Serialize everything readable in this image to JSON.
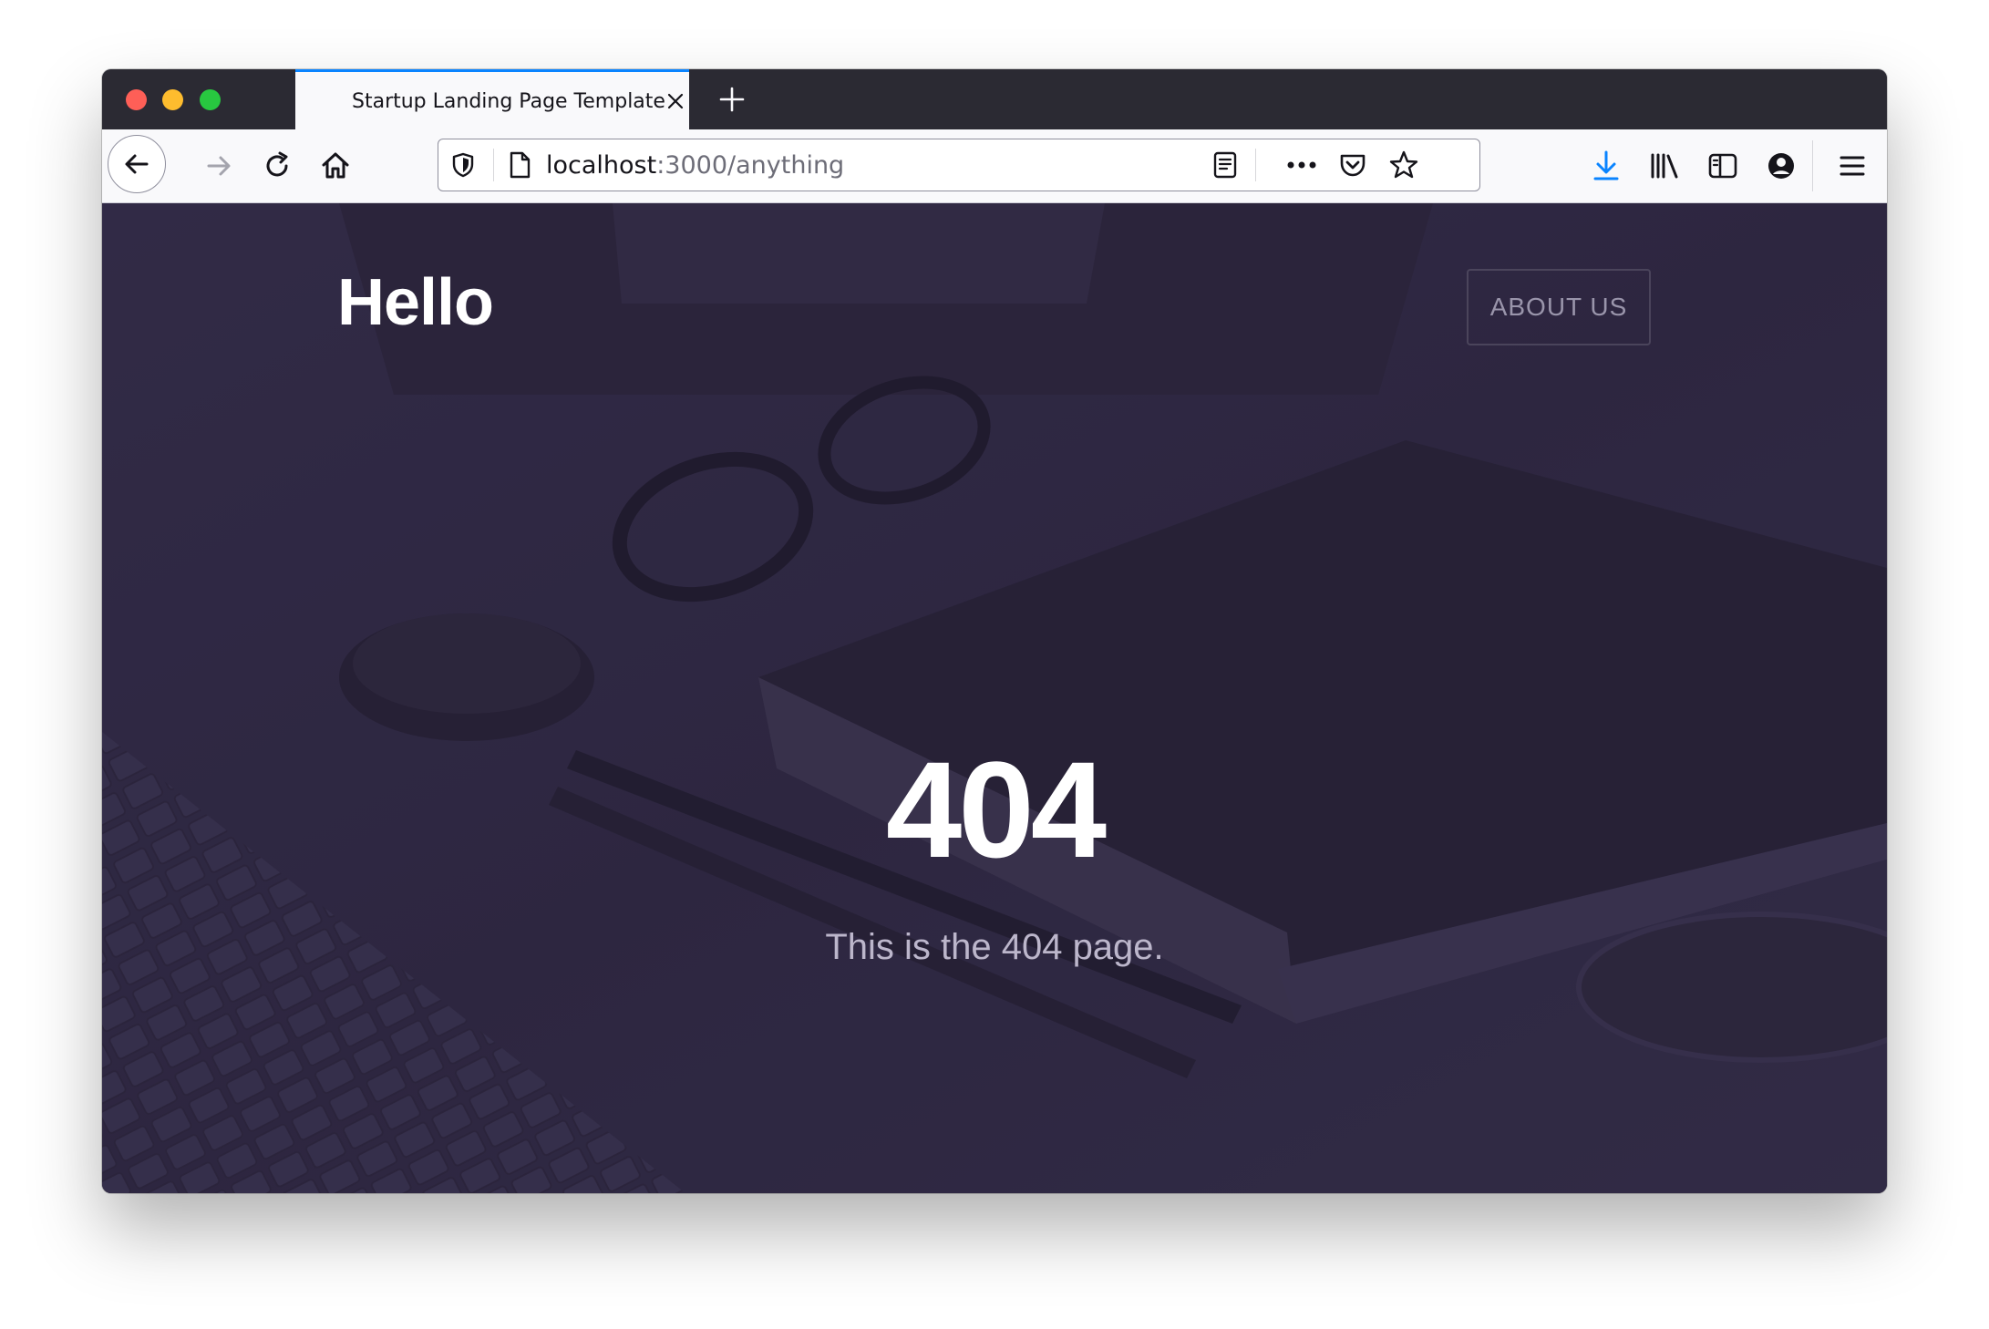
{
  "browser": {
    "tab": {
      "title": "Startup Landing Page Template"
    },
    "url": {
      "host": "localhost",
      "path": ":3000/anything"
    },
    "icons": {
      "back": "arrow-left-icon",
      "forward": "arrow-right-icon",
      "reload": "reload-icon",
      "home": "home-icon",
      "shield": "shield-icon",
      "page": "page-icon",
      "reader": "reader-view-icon",
      "more": "more-icon",
      "pocket": "pocket-icon",
      "bookmark": "star-icon",
      "downloads": "download-icon",
      "library": "library-icon",
      "sidebar": "sidebar-icon",
      "account": "account-icon",
      "menu": "hamburger-icon"
    },
    "accent": "#0a84ff"
  },
  "page": {
    "brand": "Hello",
    "nav": {
      "about_label": "ABOUT US"
    },
    "hero": {
      "code": "404",
      "message": "This is the 404 page."
    },
    "overlay_color": "#2f2841"
  }
}
